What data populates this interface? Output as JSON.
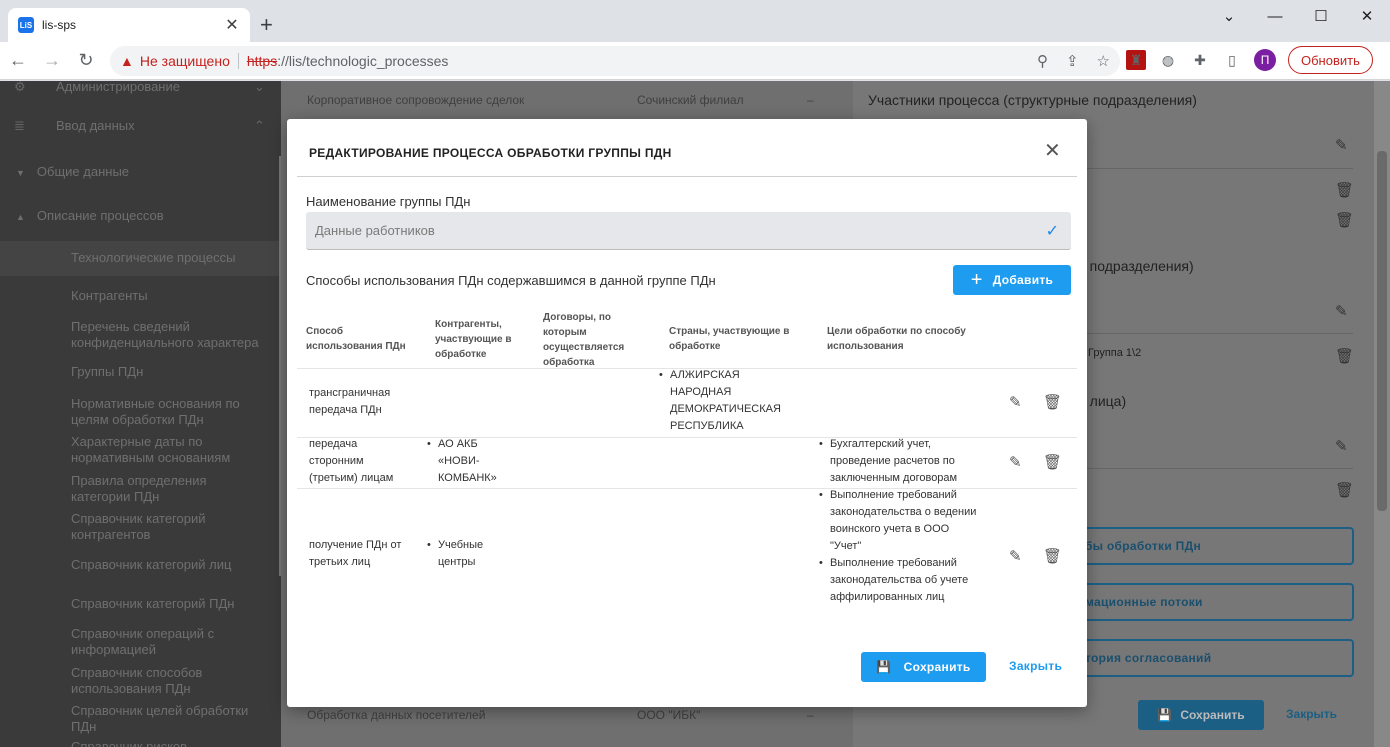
{
  "browser": {
    "tab_title": "lis-sps",
    "tab_favicon": "LiS",
    "insecure_label": "Не защищено",
    "url_scheme": "https",
    "url_rest": "://lis/technologic_processes",
    "avatar_letter": "П",
    "update_label": "Обновить"
  },
  "sidebar": {
    "items": [
      {
        "label": "Администрирование"
      },
      {
        "label": "Ввод данных"
      },
      {
        "label": "Общие данные"
      },
      {
        "label": "Описание процессов"
      },
      {
        "label": "Технологические процессы"
      },
      {
        "label": "Контрагенты"
      },
      {
        "label": "Перечень сведений конфиденциального характера"
      },
      {
        "label": "Группы ПДн"
      },
      {
        "label": "Нормативные основания по целям обработки ПДн"
      },
      {
        "label": "Характерные даты по нормативным основаниям"
      },
      {
        "label": "Правила определения категории ПДн"
      },
      {
        "label": "Справочник категорий контрагентов"
      },
      {
        "label": "Справочник категорий лиц"
      },
      {
        "label": "Справочник категорий ПДн"
      },
      {
        "label": "Справочник операций с информацией"
      },
      {
        "label": "Справочник способов использования ПДн"
      },
      {
        "label": "Справочник целей обработки ПДн"
      },
      {
        "label": "Справочник рисков"
      }
    ]
  },
  "main_bg": {
    "row1": {
      "name": "Корпоративное сопровождение сделок",
      "branch": "Сочинский филиал",
      "dash": "–"
    },
    "row2": {
      "name": "Обработка данных посетителей",
      "branch": "ООО \"ИБК\"",
      "dash": "–"
    }
  },
  "right_panel": {
    "title1": "Участники процесса (структурные подразделения)",
    "title2": "е подразделения)",
    "group_text": "Группа 1\\2",
    "title3": "е лица)",
    "btn1": "бы обработки ПДн",
    "btn2": "мационные потоки",
    "btn3": "тория согласований",
    "save": "Сохранить",
    "close": "Закрыть"
  },
  "modal": {
    "title": "РЕДАКТИРОВАНИЕ ПРОЦЕССА ОБРАБОТКИ ГРУППЫ ПДН",
    "group_label": "Наименование группы ПДн",
    "group_value": "Данные работников",
    "section_label": "Способы использования ПДн содержавшимся в данной группе ПДн",
    "add_label": "Добавить",
    "columns": {
      "c1": "Способ использования ПДн",
      "c2": "Контрагенты, участвующие в обработке",
      "c3": "Договоры, по которым осуществляется обработка",
      "c4": "Страны, участвующие в обработке",
      "c5": "Цели обработки по способу использования"
    },
    "rows": [
      {
        "method": "трансграничная передача ПДн",
        "countries": [
          "АЛЖИРСКАЯ НАРОДНАЯ ДЕМОКРАТИЧЕСКАЯ РЕСПУБЛИКА"
        ]
      },
      {
        "method": "передача сторонним (третьим) лицам",
        "contractors": [
          "АО АКБ «НОВИ-КОМБАНК»"
        ],
        "goals": [
          "Бухгалтерский учет, проведение расчетов по заключенным договорам"
        ]
      },
      {
        "method": "получение ПДн от третьих лиц",
        "contractors": [
          "Учебные центры"
        ],
        "goals": [
          "Выполнение требований законодательства о ведении воинского учета в ООО \"Учет\"",
          "Выполнение требований законодательства об учете аффилированных лиц"
        ]
      }
    ],
    "save_label": "Сохранить",
    "close_label": "Закрыть"
  }
}
